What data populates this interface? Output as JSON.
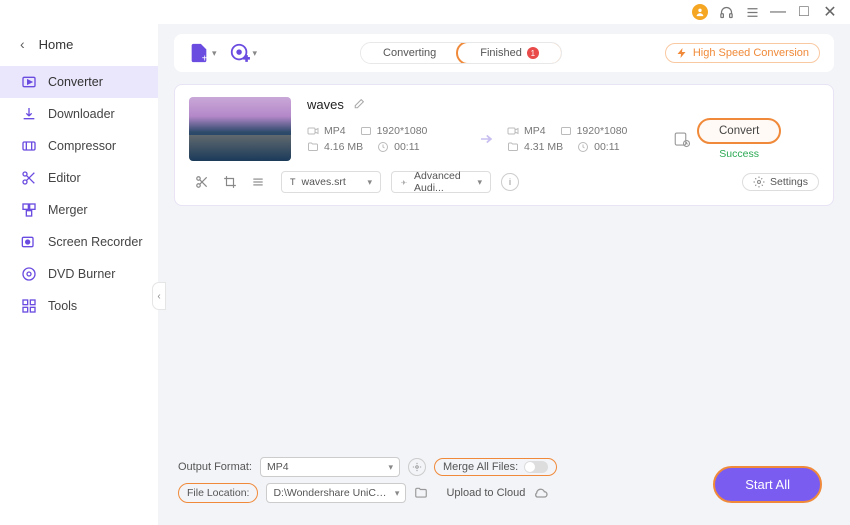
{
  "titlebar": {
    "minimize": "—",
    "maximize": "□",
    "close": "✕"
  },
  "home": {
    "label": "Home"
  },
  "nav": {
    "items": [
      {
        "label": "Converter"
      },
      {
        "label": "Downloader"
      },
      {
        "label": "Compressor"
      },
      {
        "label": "Editor"
      },
      {
        "label": "Merger"
      },
      {
        "label": "Screen Recorder"
      },
      {
        "label": "DVD Burner"
      },
      {
        "label": "Tools"
      }
    ]
  },
  "toolbar": {
    "tabs": {
      "converting": "Converting",
      "finished": "Finished",
      "finished_count": "1"
    },
    "high_speed": "High Speed Conversion"
  },
  "file": {
    "name": "waves",
    "src": {
      "format": "MP4",
      "resolution": "1920*1080",
      "size": "4.16 MB",
      "duration": "00:11"
    },
    "dst": {
      "format": "MP4",
      "resolution": "1920*1080",
      "size": "4.31 MB",
      "duration": "00:11"
    },
    "convert_label": "Convert",
    "status": "Success",
    "subtitle_file": "waves.srt",
    "audio_label": "Advanced Audi...",
    "settings_label": "Settings"
  },
  "bottom": {
    "output_format_label": "Output Format:",
    "output_format_value": "MP4",
    "merge_label": "Merge All Files:",
    "file_location_label": "File Location:",
    "file_location_value": "D:\\Wondershare UniConverter 1",
    "upload_cloud": "Upload to Cloud",
    "start_all": "Start All"
  }
}
